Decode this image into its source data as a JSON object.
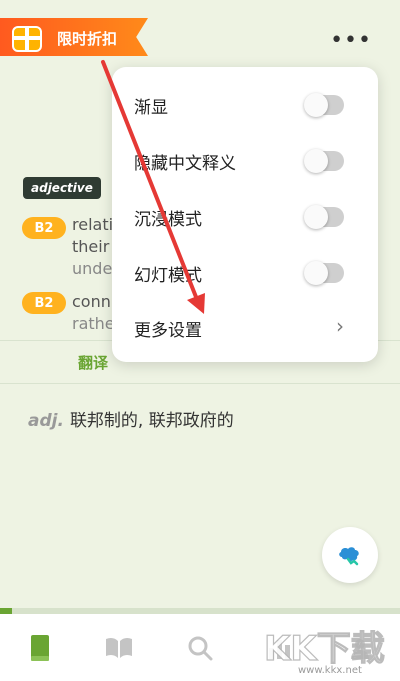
{
  "header": {
    "promo_label": "限时折扣",
    "more_icon": "more-dots-icon"
  },
  "entry": {
    "part_of_speech": "adjective",
    "senses": [
      {
        "level": "B2",
        "lines": [
          "relati",
          "their",
          "unde"
        ]
      },
      {
        "level": "B2",
        "lines": [
          "conn",
          "rathe"
        ]
      }
    ]
  },
  "tabs": [
    {
      "label": "翻译",
      "active": true
    }
  ],
  "translation": {
    "pos": "adj.",
    "text": "联邦制的, 联邦政府的"
  },
  "menu": {
    "items": [
      {
        "label": "渐显",
        "type": "toggle",
        "on": false
      },
      {
        "label": "隐藏中文释义",
        "type": "toggle",
        "on": false
      },
      {
        "label": "沉浸模式",
        "type": "toggle",
        "on": false
      },
      {
        "label": "幻灯模式",
        "type": "toggle",
        "on": false
      },
      {
        "label": "更多设置",
        "type": "link"
      }
    ]
  },
  "bottom_nav": {
    "items": [
      "book-icon",
      "open-book-icon",
      "search-icon",
      "stats-icon",
      "profile-icon"
    ]
  },
  "watermark": {
    "text": "www.kkx.net"
  },
  "colors": {
    "accent": "#6aa533",
    "level_badge": "#ffb21f",
    "promo": "#ff6a1c",
    "annotation_arrow": "#e53935"
  }
}
